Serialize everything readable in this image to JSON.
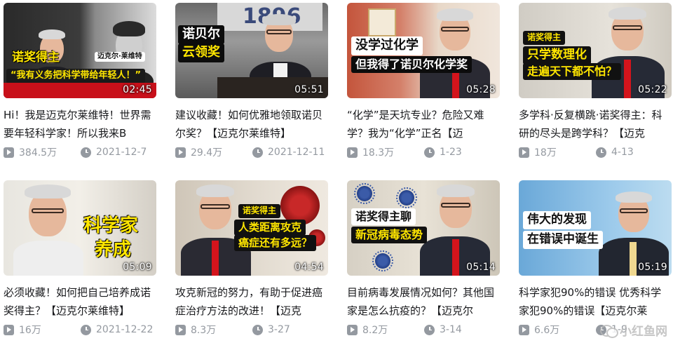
{
  "videos": [
    {
      "duration": "02:45",
      "title": "Hi！我是迈克尔莱维特！世界需要年轻科学家！所以我来B",
      "views": "384.5万",
      "date": "2021-12-7",
      "captions": [
        "诺奖得主",
        "迈克尔·莱维特",
        "“我有义务把科学带给年轻人！”"
      ]
    },
    {
      "duration": "05:51",
      "title": "建议收藏！如何优雅地领取诺贝尔奖？【迈克尔莱维特】",
      "views": "29.4万",
      "date": "2021-12-11",
      "captions": [
        "诺贝尔",
        "云领奖",
        "1896"
      ]
    },
    {
      "duration": "05:28",
      "title": "“化学”是天坑专业？危险又难学？我为“化学”正名【迈",
      "views": "18.3万",
      "date": "1-23",
      "captions": [
        "没学过化学",
        "但我得了诺贝尔化学奖"
      ]
    },
    {
      "duration": "05:22",
      "title": "多学科·反复横跳·诺奖得主：科研的尽头是跨学科？【迈克",
      "views": "18万",
      "date": "4-13",
      "captions": [
        "诺奖得主",
        "只学数理化",
        "走遍天下都不怕？"
      ]
    },
    {
      "duration": "05:09",
      "title": "必须收藏！如何把自己培养成诺奖得主？【迈克尔莱维特】",
      "views": "16万",
      "date": "2021-12-22",
      "captions": [
        "科学家",
        "养成"
      ]
    },
    {
      "duration": "04:54",
      "title": "攻克新冠的努力，有助于促进癌症治疗方法的改进！【迈克",
      "views": "8.3万",
      "date": "3-27",
      "captions": [
        "诺奖得主",
        "人类距离攻克",
        "癌症还有多远？"
      ]
    },
    {
      "duration": "05:14",
      "title": "目前病毒发展情况如何？其他国家是怎么抗疫的？【迈克尔",
      "views": "8.2万",
      "date": "3-14",
      "captions": [
        "诺奖得主聊",
        "新冠病毒态势"
      ]
    },
    {
      "duration": "05:19",
      "title": "科学家犯90%的错误 优秀科学家犯90%的错误【迈克尔莱",
      "views": "6.6万",
      "date": "1-9",
      "captions": [
        "伟大的发现",
        "在错误中诞生"
      ]
    }
  ],
  "watermark": {
    "text": "小红鱼网"
  },
  "colors": {
    "meta": "#9499a0",
    "title": "#18191c",
    "caption_yellow": "#ffe600",
    "tie_red": "#d4141c"
  }
}
